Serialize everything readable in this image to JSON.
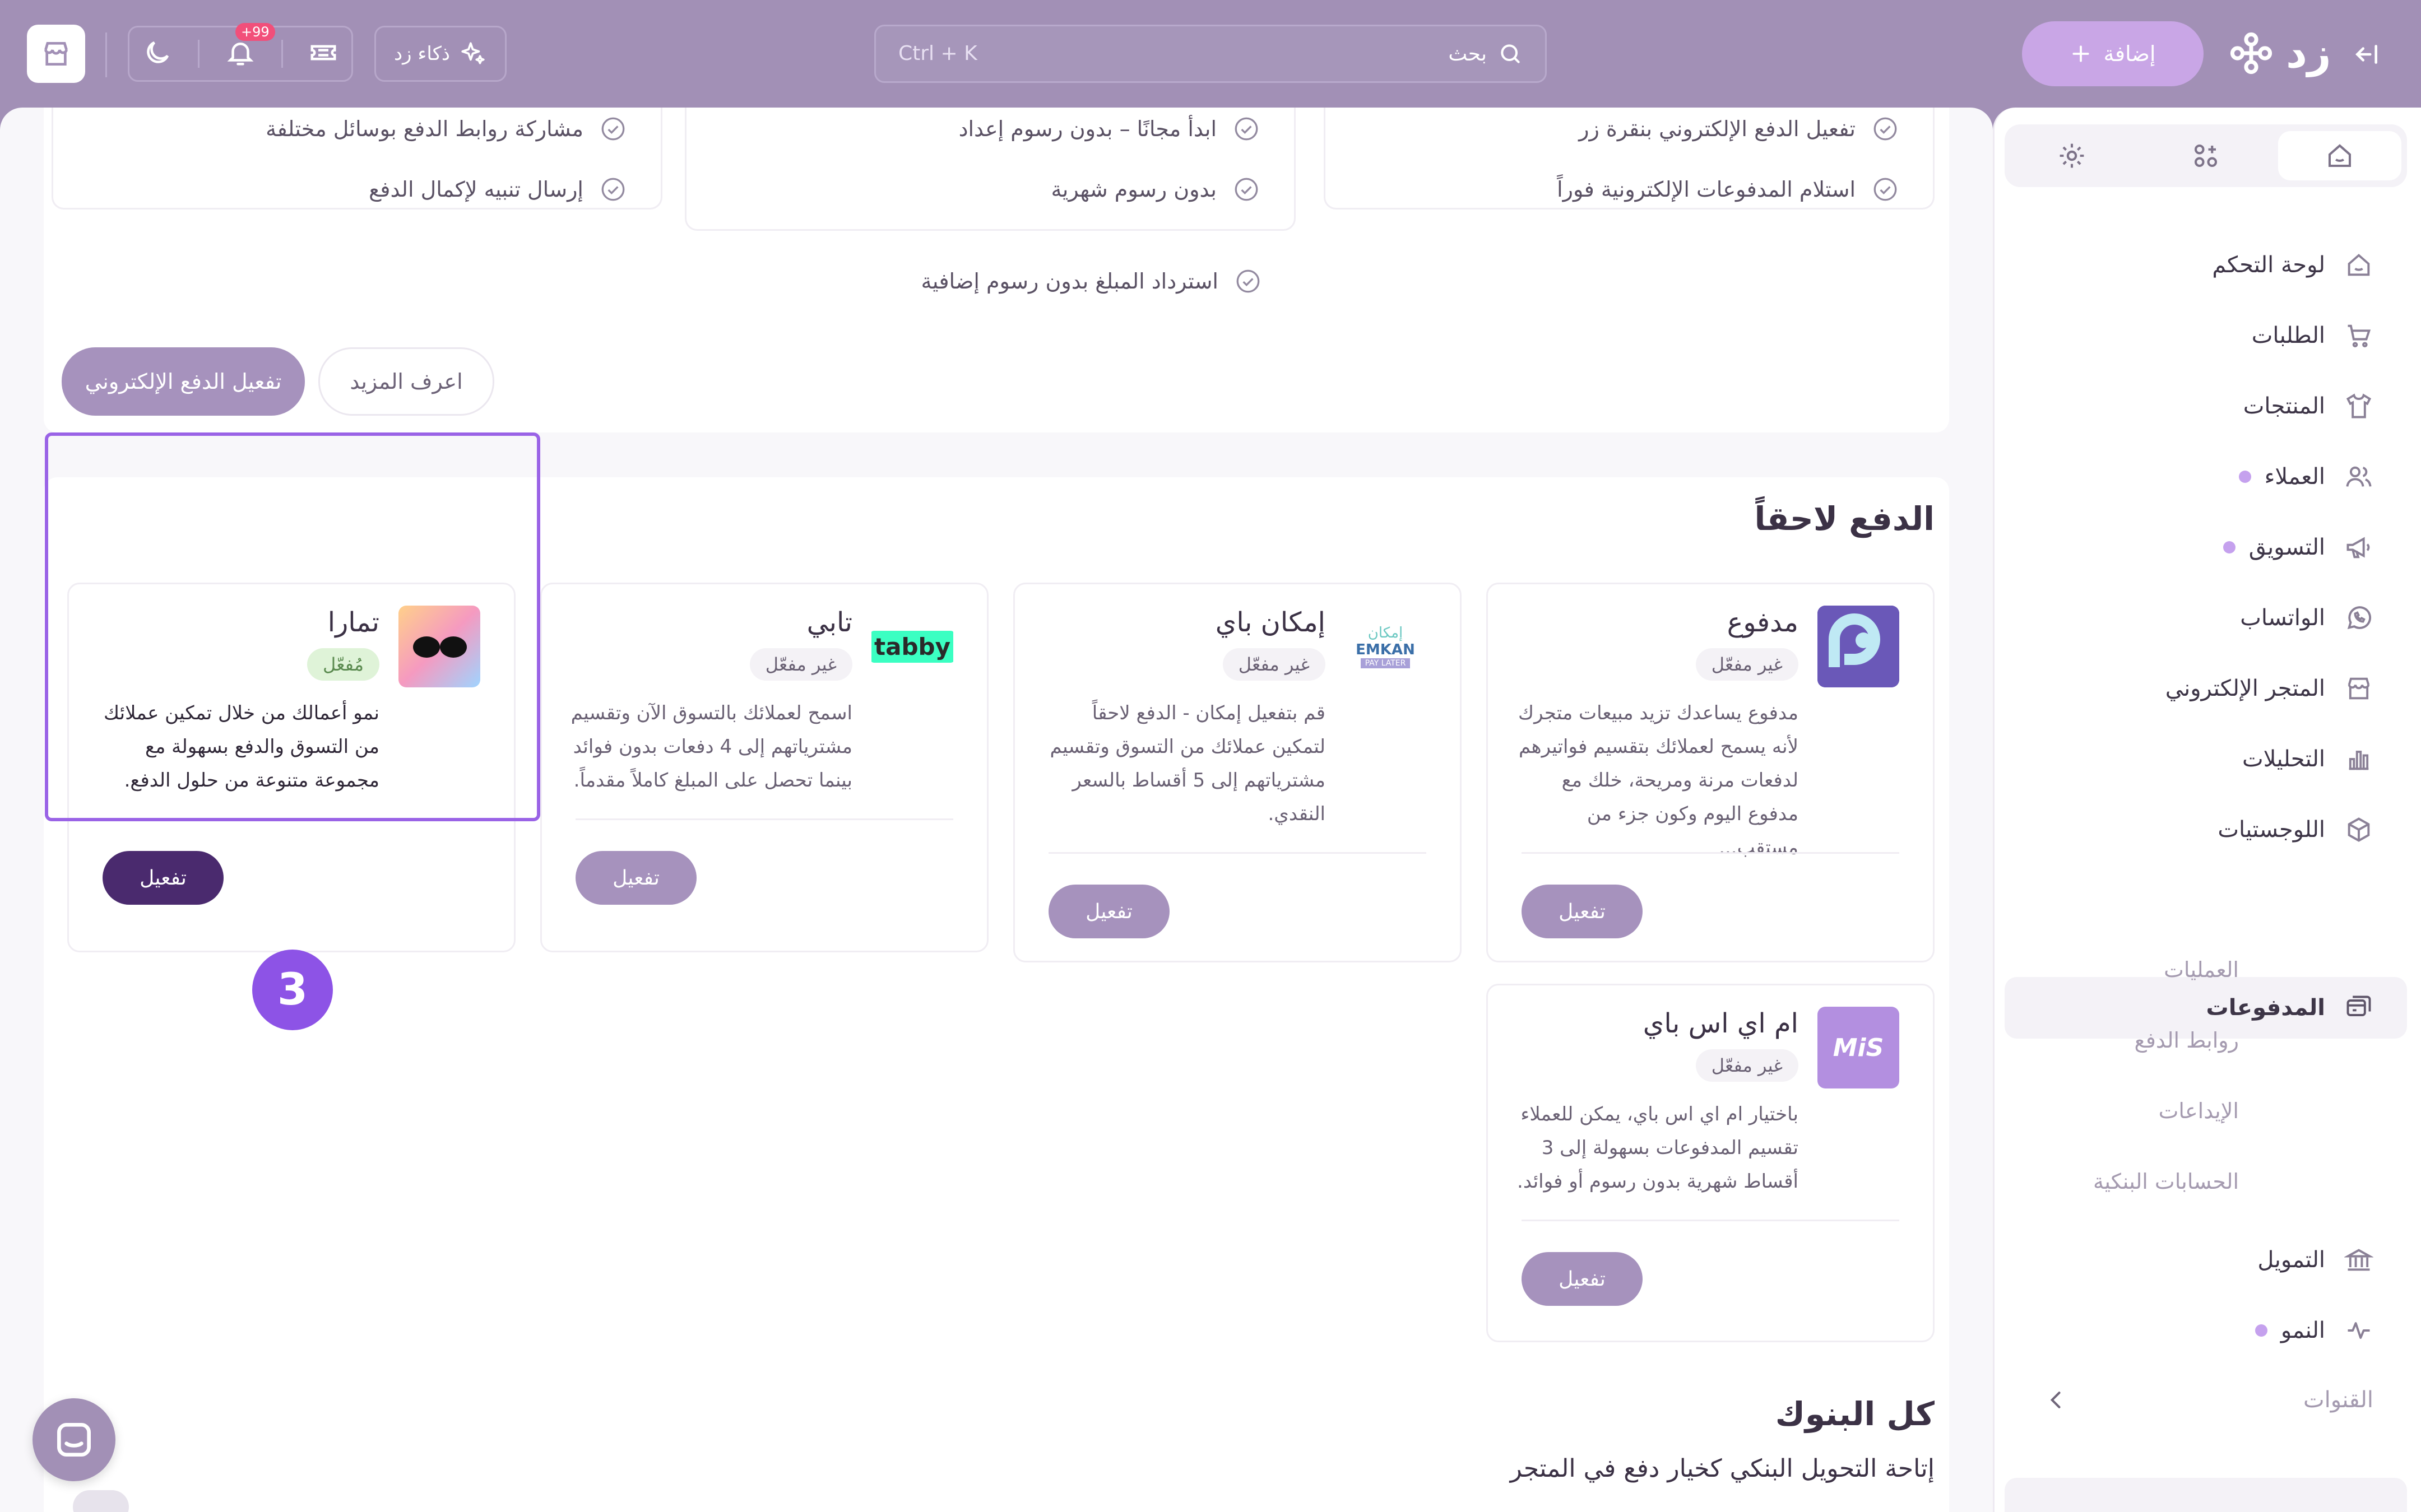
{
  "topbar": {
    "brand": "زد",
    "add_label": "إضافة",
    "search_label": "بحث",
    "search_shortcut": "Ctrl + K",
    "ai_label": "ذكاء زد",
    "notifications_badge": "+99"
  },
  "sidebar": {
    "items": [
      {
        "label": "لوحة التحكم",
        "icon": "home-icon"
      },
      {
        "label": "الطلبات",
        "icon": "cart-icon"
      },
      {
        "label": "المنتجات",
        "icon": "shirt-icon"
      },
      {
        "label": "العملاء",
        "icon": "users-icon"
      },
      {
        "label": "التسويق",
        "icon": "megaphone-icon"
      },
      {
        "label": "الواتساب",
        "icon": "whatsapp-icon"
      },
      {
        "label": "المتجر الإلكتروني",
        "icon": "store-icon"
      },
      {
        "label": "التحليلات",
        "icon": "chart-icon"
      },
      {
        "label": "اللوجستيات",
        "icon": "box-icon"
      },
      {
        "label": "المدفوعات",
        "icon": "payments-icon"
      }
    ],
    "payments_sub": [
      "العمليات",
      "روابط الدفع",
      "الإيداعات",
      "الحسابات البنكية"
    ],
    "items_after": [
      {
        "label": "التمويل",
        "icon": "bank-icon"
      },
      {
        "label": "النمو",
        "icon": "pulse-icon"
      }
    ],
    "channels_label": "القنوات"
  },
  "features": {
    "col1": [
      "تفعيل الدفع الإلكتروني بنقرة زر",
      "استلام المدفوعات الإلكترونية فوراً"
    ],
    "col2": [
      "ابدأ مجانًا – بدون رسوم إعداد",
      "بدون رسوم شهرية",
      "استرداد المبلغ بدون رسوم إضافية"
    ],
    "col3": [
      "مشاركة روابط الدفع بوسائل مختلفة",
      "إرسال تنبيه لإكمال الدفع"
    ]
  },
  "epay": {
    "activate_label": "تفعيل الدفع الإلكتروني",
    "learn_more_label": "اعرف المزيد"
  },
  "bnpl": {
    "title": "الدفع لاحقاً",
    "providers": [
      {
        "name": "مدفوع",
        "status": "غير مفعّل",
        "desc": "مدفوع يساعدك تزيد مبيعات متجرك لأنه يسمح لعملائك بتقسيم فواتيرهم لدفعات مرنة ومريحة، خلك مع مدفوع اليوم وكون جزء من مستقب...",
        "button": "تفعيل"
      },
      {
        "name": "إمكان باي",
        "logo_text": "إمكان",
        "logo_text_2": "EMKAN",
        "logo_text_3": "PAY LATER",
        "status": "غير مفعّل",
        "desc": "قم بتفعيل إمكان - الدفع لاحقاً لتمكين عملائك من التسوق وتقسيم مشترياتهم إلى 5 أقساط بالسعر النقدي.",
        "button": "تفعيل"
      },
      {
        "name": "تابي",
        "logo_text": "tabby",
        "status": "غير مفعّل",
        "desc": "اسمح لعملائك بالتسوق الآن وتقسيم مشترياتهم إلى 4 دفعات بدون فوائد بينما تحصل على المبلغ كاملاً مقدماً.",
        "button": "تفعيل"
      },
      {
        "name": "تمارا",
        "status": "مُفعّل",
        "desc": "نمو أعمالك من خلال تمكين عملائك من التسوق والدفع بسهولة مع مجموعة متنوعة من حلول الدفع.",
        "button": "تفعيل"
      },
      {
        "name": "ام اي اس باي",
        "logo_text": "MiS",
        "status": "غير مفعّل",
        "desc": "باختيار ام اي اس باي، يمكن للعملاء تقسيم المدفوعات بسهولة إلى 3 أقساط شهرية بدون رسوم أو فوائد.",
        "button": "تفعيل"
      }
    ]
  },
  "banks": {
    "title": "كل البنوك",
    "subtitle": "إتاحة التحويل البنكي كخيار دفع في المتجر"
  },
  "step_badge": "3",
  "colors": {
    "primary": "#a290b6",
    "accent": "#8d53e6",
    "active_button": "#4a2a6e",
    "enabled_badge": "#dff3d8"
  }
}
